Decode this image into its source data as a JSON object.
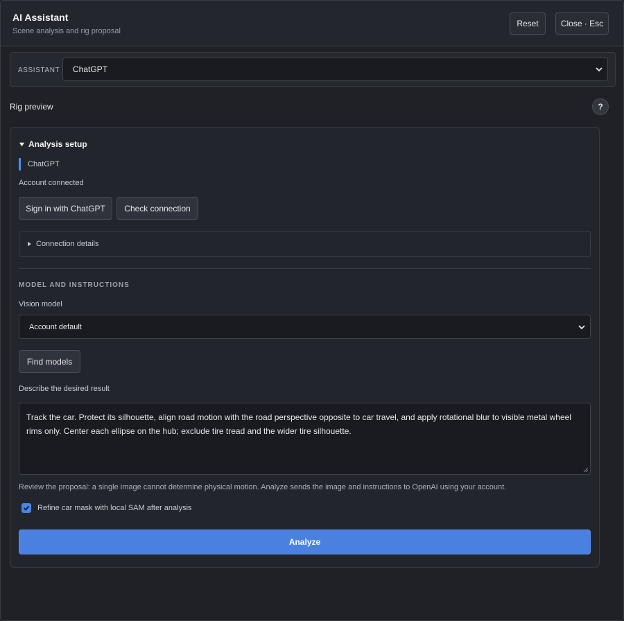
{
  "header": {
    "title": "AI Assistant",
    "subtitle": "Scene analysis and rig proposal",
    "reset_label": "Reset",
    "close_label": "Close · Esc"
  },
  "assistant": {
    "label": "ASSISTANT",
    "selected": "ChatGPT"
  },
  "rig_preview": {
    "title": "Rig preview",
    "help_label": "?"
  },
  "analysis": {
    "heading": "Analysis setup",
    "provider_tag": "ChatGPT",
    "account_status": "Account connected",
    "signin_label": "Sign in with ChatGPT",
    "check_label": "Check connection",
    "connection_details_label": "Connection details",
    "group_label": "MODEL AND INSTRUCTIONS",
    "vision_model_label": "Vision model",
    "vision_model_selected": "Account default",
    "find_models_label": "Find models",
    "describe_label": "Describe the desired result",
    "instructions": "Track the car. Protect its silhouette, align road motion with the road perspective opposite to car travel, and apply rotational blur to visible metal wheel rims only. Center each ellipse on the hub; exclude tire tread and the wider tire silhouette.",
    "review_note": "Review the proposal: a single image cannot determine physical motion. Analyze sends the image and instructions to OpenAI using your account.",
    "refine_label": "Refine car mask with local SAM after analysis",
    "refine_checked": true,
    "analyze_label": "Analyze"
  },
  "colors": {
    "accent": "#4a81e0",
    "background": "#202127"
  }
}
